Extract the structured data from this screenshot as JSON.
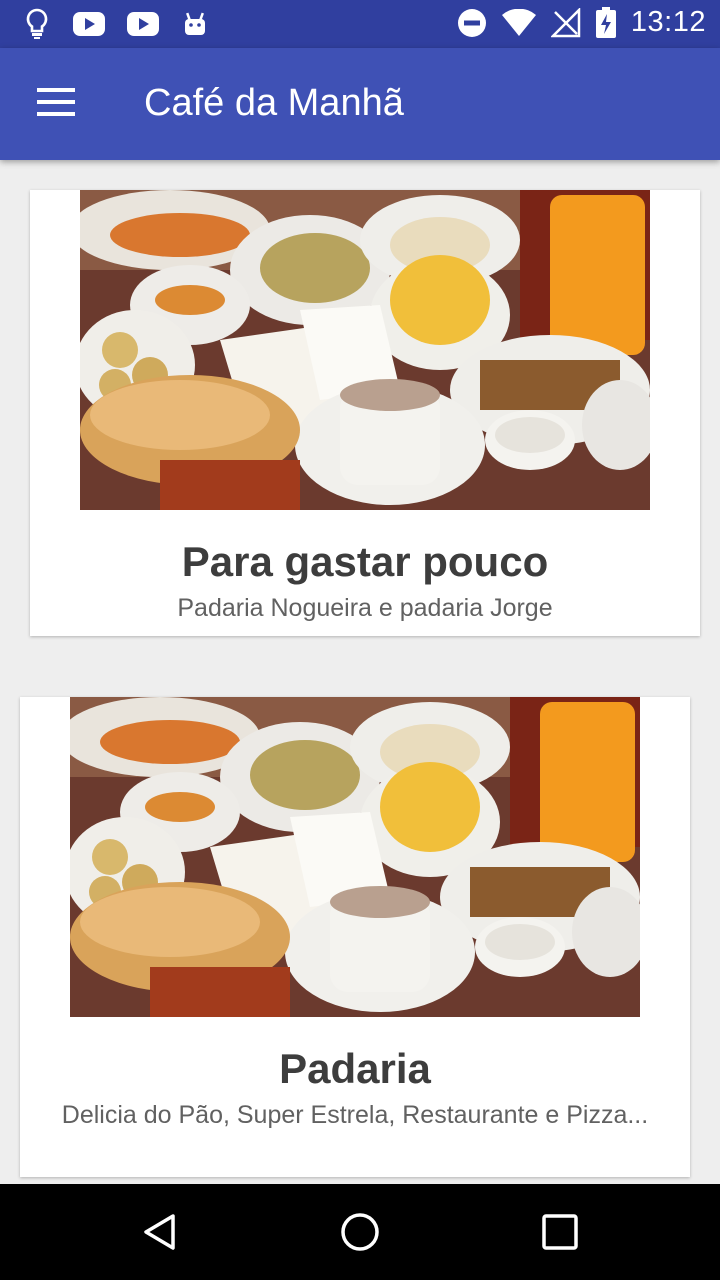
{
  "status_bar": {
    "time": "13:12",
    "left_icons": [
      "lightbulb-icon",
      "youtube-icon",
      "youtube-icon",
      "android-icon"
    ],
    "right_icons": [
      "do-not-disturb-icon",
      "wifi-icon",
      "no-signal-icon",
      "battery-charging-icon"
    ]
  },
  "app_bar": {
    "title": "Café da Manhã",
    "menu_icon": "hamburger-menu-icon",
    "color": "#3f51b5",
    "status_color": "#303f9f"
  },
  "cards": [
    {
      "title": "Para gastar pouco",
      "subtitle": "Padaria Nogueira e padaria Jorge",
      "image": "breakfast-spread-photo"
    },
    {
      "title": "Padaria",
      "subtitle": "Delicia do Pão, Super Estrela, Restaurante  e Pizza...",
      "image": "breakfast-spread-photo"
    }
  ],
  "nav_bar": {
    "buttons": [
      "back-icon",
      "home-icon",
      "recents-icon"
    ]
  }
}
